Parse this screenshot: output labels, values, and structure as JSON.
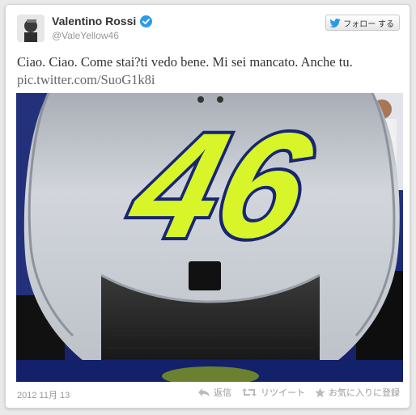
{
  "user": {
    "name": "Valentino Rossi",
    "handle": "@ValeYellow46"
  },
  "follow_button": {
    "label": "フォロー する"
  },
  "tweet": {
    "text": "Ciao. Ciao. Come stai?ti vedo bene. Mi sei mancato. Anche tu.",
    "link": "pic.twitter.com/SuoG1k8i",
    "date": "2012 11月 13"
  },
  "photo": {
    "number": "46"
  },
  "actions": {
    "reply": "返信",
    "retweet": "リツイート",
    "favorite": "お気に入りに登録"
  },
  "colors": {
    "verified": "#2b9be8",
    "number_fill": "#d8f52a",
    "fairing": "#c9cdd3",
    "text": "#333333",
    "muted": "#999999"
  }
}
